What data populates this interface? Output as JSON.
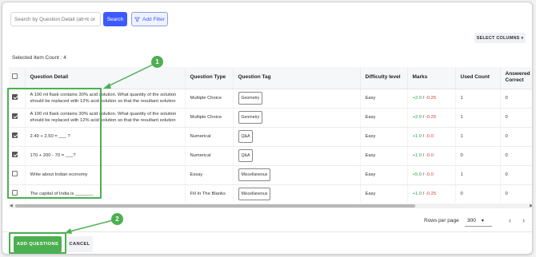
{
  "toolbar": {
    "search_placeholder": "Search by Question Detail (alt+k or",
    "search_label": "Search",
    "filter_label": "Add Filter",
    "select_columns_label": "SELECT COLUMNS"
  },
  "selected_count": "Selected Item Count : 4",
  "table": {
    "headers": [
      "Question Detail",
      "Question Type",
      "Question Tag",
      "Difficulty level",
      "Marks",
      "Used Count",
      "Answered Correct"
    ],
    "rows": [
      {
        "checked": true,
        "detail": "A 100 ml flask contains 30% acid solution. What quantity of the solution",
        "detail2": "should be replaced with 12% acid solution so that the resultant solution",
        "type": "Multiple Choice",
        "tag": "Geometry",
        "difficulty": "Easy",
        "plus": "+2.0",
        "minus": "-0.25",
        "used": "1",
        "correct": "0"
      },
      {
        "checked": true,
        "detail": "A 100 ml flask contains 30% acid solution. What quantity of the solution",
        "detail2": "should be replaced with 12% acid solution so that the resultant solution",
        "type": "Multiple Choice",
        "tag": "Geometry",
        "difficulty": "Easy",
        "plus": "+2.0",
        "minus": "-0.25",
        "used": "1",
        "correct": "0"
      },
      {
        "checked": true,
        "detail": "2.49 + 2.50 = ___ ?",
        "detail2": "",
        "type": "Numerical",
        "tag": "Q&A",
        "difficulty": "Easy",
        "plus": "+1.0",
        "minus": "-0.0",
        "used": "1",
        "correct": "0"
      },
      {
        "checked": true,
        "detail": "170 + 200 - 70 = ___?",
        "detail2": "",
        "type": "Numerical",
        "tag": "Q&A",
        "difficulty": "Easy",
        "plus": "+1.0",
        "minus": "-0.0",
        "used": "0",
        "correct": "0"
      },
      {
        "checked": false,
        "detail": "Write about Indian economy",
        "detail2": "",
        "type": "Essay",
        "tag": "Miscellaneous",
        "difficulty": "Easy",
        "plus": "+5.0",
        "minus": "-0.0",
        "used": "1",
        "correct": "0"
      },
      {
        "checked": false,
        "detail": "The capital of India is _______",
        "detail2": "",
        "type": "Fill In The Blanks",
        "tag": "Miscellaneous",
        "difficulty": "Easy",
        "plus": "+1.0",
        "minus": "-0.25",
        "used": "0",
        "correct": "0"
      }
    ]
  },
  "marks_separator": "/",
  "pagination": {
    "rows_label": "Rows per page",
    "rows_value": "300"
  },
  "footer": {
    "add_label": "ADD QUESTIONS",
    "cancel_label": "CANCEL"
  },
  "annotations": {
    "badge1": "1",
    "badge2": "2",
    "color": "#4caf50"
  }
}
